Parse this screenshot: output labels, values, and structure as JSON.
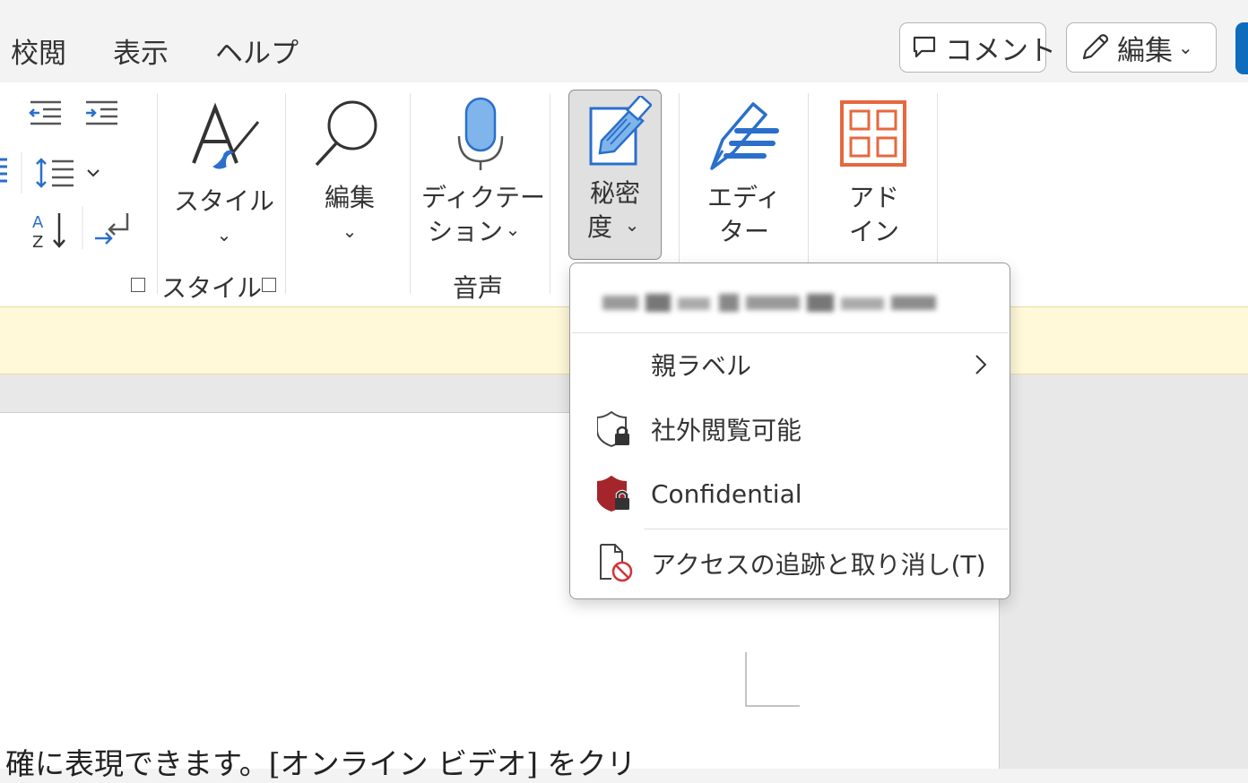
{
  "tabs": [
    "校閲",
    "表示",
    "ヘルプ"
  ],
  "top_buttons": {
    "comment": "コメント",
    "editing": "編集"
  },
  "ribbon": {
    "style_button": "スタイル",
    "styles_group_label": "スタイル",
    "edit_button": "編集",
    "dictation_button": {
      "line1": "ディクテー",
      "line2": "ション"
    },
    "voice_group_label": "音声",
    "sensitivity_button": {
      "line1": "秘密",
      "line2": "度"
    },
    "editor_button": {
      "line1": "エディ",
      "line2": "ター"
    },
    "addin_button": {
      "line1": "アド",
      "line2": "イン"
    }
  },
  "sensitivity_menu": {
    "items": [
      {
        "label": "親ラベル",
        "icon": "chevron-right-icon"
      },
      {
        "label": "社外閲覧可能",
        "icon": "shield-lock-outline-icon"
      },
      {
        "label": "Confidential",
        "icon": "shield-lock-red-icon"
      },
      {
        "label": "アクセスの追跡と取り消し(T)",
        "icon": "document-blocked-icon"
      }
    ]
  },
  "document": {
    "visible_text": "確に表現できます。[オンライン ビデオ] をクリ"
  },
  "colors": {
    "accent_blue": "#2a6fcb",
    "addin_orange": "#e5683f",
    "confidential_red": "#a4262c",
    "message_bar": "#fff8d9"
  }
}
